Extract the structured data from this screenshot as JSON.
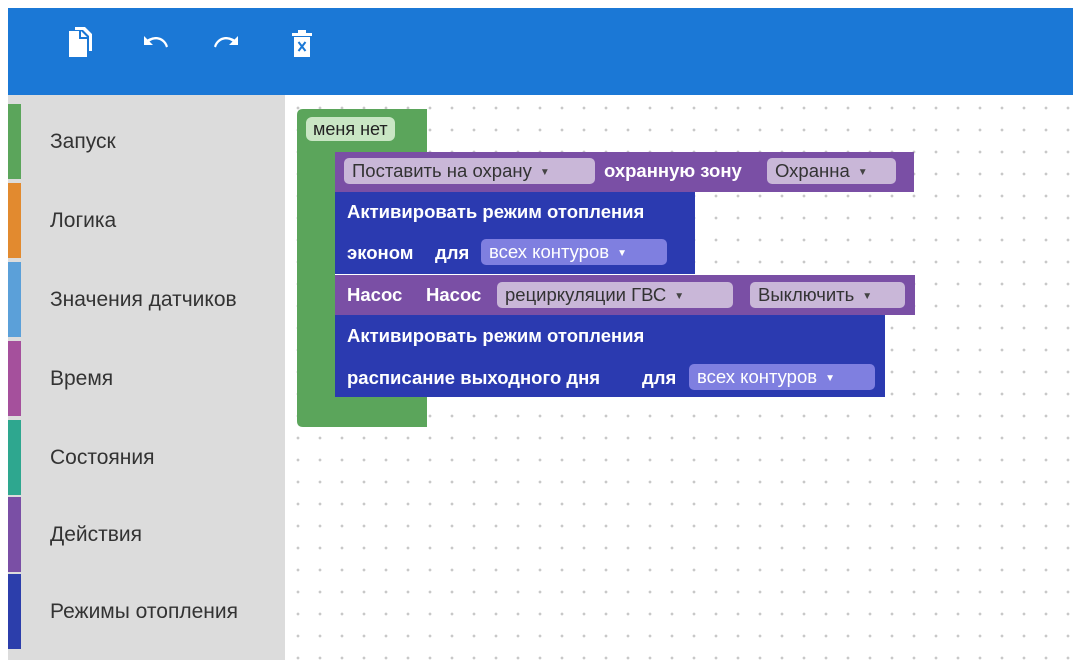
{
  "toolbar": {
    "icons": [
      "copy-icon",
      "undo-icon",
      "redo-icon",
      "delete-icon"
    ],
    "color": "#1b78d6"
  },
  "sidebar": {
    "categories": [
      {
        "label": "Запуск",
        "color": "#5ba55b"
      },
      {
        "label": "Логика",
        "color": "#e28a2f"
      },
      {
        "label": "Значения датчиков",
        "color": "#5ba0d9"
      },
      {
        "label": "Время",
        "color": "#a5509c"
      },
      {
        "label": "Состояния",
        "color": "#2ea78f"
      },
      {
        "label": "Действия",
        "color": "#7a4fa5"
      },
      {
        "label": "Режимы отопления",
        "color": "#2c3eab"
      }
    ]
  },
  "workspace": {
    "container": {
      "label": "меня нет",
      "color": "#5ba55b"
    },
    "blocks": {
      "arm": {
        "text1": "Поставить на охрану",
        "text2": "охранную зону",
        "dropdown1": "Поставить на охрану",
        "dropdown2": "Охранна",
        "color": "#7a4fa5"
      },
      "heat1": {
        "line1": "Активировать режим отопления",
        "mode": "эконом",
        "for": "для",
        "dropdown": "всех контуров",
        "color": "#2b3ab0"
      },
      "pump": {
        "text1": "Насос",
        "text2": "Насос",
        "dropdown1": "рециркуляции ГВС",
        "dropdown2": "Выключить",
        "color": "#7a4fa5"
      },
      "heat2": {
        "line1": "Активировать режим отопления",
        "mode": "расписание выходного дня",
        "for": "для",
        "dropdown": "всех контуров",
        "color": "#2b3ab0"
      }
    }
  }
}
